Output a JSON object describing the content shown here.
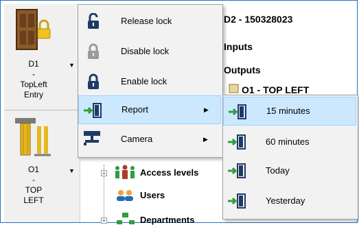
{
  "devices": [
    {
      "line1": "D1",
      "line2": "-",
      "line3": "TopLeft",
      "line4": "Entry"
    },
    {
      "line1": "O1",
      "line2": "-",
      "line3": "TOP",
      "line4": "LEFT"
    }
  ],
  "background": {
    "door_title": "D2 - 150328023",
    "inputs": "Inputs",
    "outputs": "Outputs",
    "output_item": "O1 - TOP LEFT",
    "tree": [
      "Access levels",
      "Users",
      "Departments"
    ]
  },
  "context_menu": {
    "items": [
      {
        "label": "Release lock",
        "icon": "unlocked-padlock-icon"
      },
      {
        "label": "Disable lock",
        "icon": "disabled-padlock-icon"
      },
      {
        "label": "Enable lock",
        "icon": "locked-padlock-icon"
      },
      {
        "label": "Report",
        "icon": "door-report-icon",
        "submenu": true,
        "highlighted": true
      },
      {
        "label": "Camera",
        "icon": "camera-icon",
        "submenu": true
      }
    ]
  },
  "report_submenu": {
    "items": [
      {
        "label": "15 minutes",
        "highlighted": true
      },
      {
        "label": "60 minutes"
      },
      {
        "label": "Today"
      },
      {
        "label": "Yesterday"
      }
    ]
  },
  "colors": {
    "highlight": "#cce8ff",
    "highlight_border": "#99d1ff",
    "frame": "#1e73be",
    "door_green": "#2e9e3e"
  }
}
